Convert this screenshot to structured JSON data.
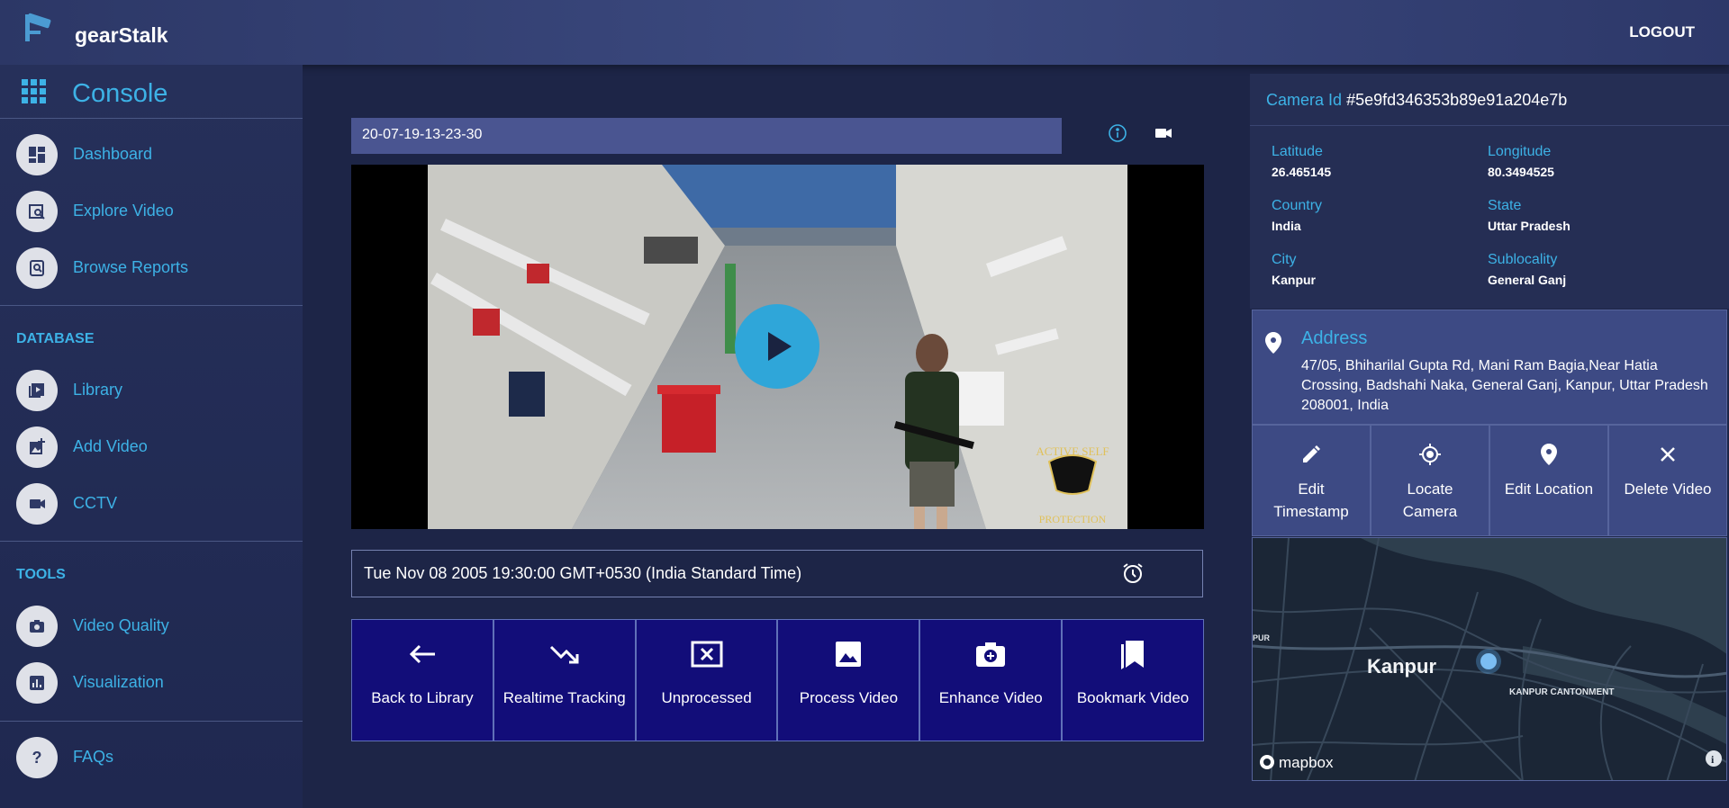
{
  "app": {
    "title": "gearStalk",
    "logout": "LOGOUT"
  },
  "sidebar": {
    "console": "Console",
    "items": [
      {
        "label": "Dashboard",
        "icon": "dashboard-icon"
      },
      {
        "label": "Explore Video",
        "icon": "explore-video-icon"
      },
      {
        "label": "Browse Reports",
        "icon": "browse-reports-icon"
      }
    ],
    "database_label": "DATABASE",
    "database_items": [
      {
        "label": "Library",
        "icon": "library-icon"
      },
      {
        "label": "Add Video",
        "icon": "add-video-icon"
      },
      {
        "label": "CCTV",
        "icon": "cctv-icon"
      }
    ],
    "tools_label": "TOOLS",
    "tools_items": [
      {
        "label": "Video Quality",
        "icon": "camera-icon"
      },
      {
        "label": "Visualization",
        "icon": "chart-icon"
      }
    ],
    "faq": {
      "label": "FAQs",
      "icon": "help-icon"
    }
  },
  "video": {
    "name": "20-07-19-13-23-30",
    "datetime": "Tue Nov 08 2005 19:30:00 GMT+0530 (India Standard Time)",
    "watermark": "ACTIVE SELF PROTECTION"
  },
  "actions": [
    {
      "label": "Back to Library",
      "icon": "arrow-left-icon"
    },
    {
      "label": "Realtime Tracking",
      "icon": "trending-down-icon"
    },
    {
      "label": "Unprocessed",
      "icon": "close-box-icon"
    },
    {
      "label": "Process Video",
      "icon": "image-icon"
    },
    {
      "label": "Enhance Video",
      "icon": "add-camera-icon"
    },
    {
      "label": "Bookmark Video",
      "icon": "bookmarks-icon"
    }
  ],
  "camera": {
    "id_label": "Camera Id",
    "id": "#5e9fd346353b89e91a204e7b",
    "latitude_label": "Latitude",
    "latitude": "26.465145",
    "longitude_label": "Longitude",
    "longitude": "80.3494525",
    "country_label": "Country",
    "country": "India",
    "state_label": "State",
    "state": "Uttar Pradesh",
    "city_label": "City",
    "city": "Kanpur",
    "sublocality_label": "Sublocality",
    "sublocality": "General Ganj",
    "address_label": "Address",
    "address": "47/05, Bhiharilal Gupta Rd, Mani Ram Bagia,Near Hatia Crossing, Badshahi Naka, General Ganj, Kanpur, Uttar Pradesh 208001, India"
  },
  "camera_actions": [
    {
      "label": "Edit Timestamp",
      "icon": "pencil-icon"
    },
    {
      "label": "Locate Camera",
      "icon": "locate-icon"
    },
    {
      "label": "Edit Location",
      "icon": "location-pin-icon"
    },
    {
      "label": "Delete Video",
      "icon": "close-icon"
    }
  ],
  "map": {
    "city": "Kanpur",
    "cantonment": "KANPUR CANTONMENT",
    "edge_label": "PUR",
    "brand": "mapbox"
  },
  "colors": {
    "accent": "#3db2e6",
    "action_bg": "#120d79",
    "panel": "#3d4a84"
  }
}
